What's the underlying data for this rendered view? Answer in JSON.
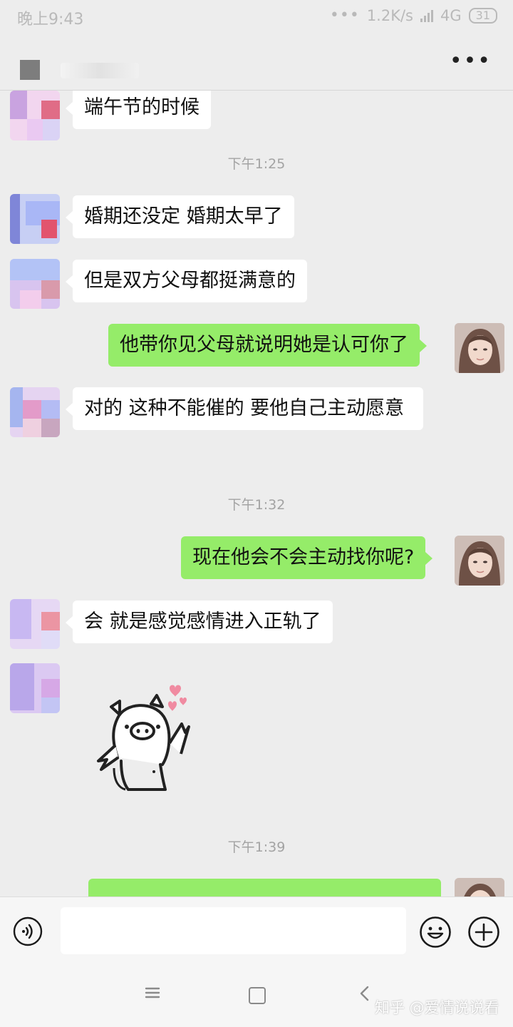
{
  "status_bar": {
    "time": "晚上9:43",
    "network_speed": "1.2K/s",
    "network_type": "4G",
    "battery": "31"
  },
  "title_bar": {
    "more_icon": "more-horizontal-icon"
  },
  "messages": [
    {
      "side": "in",
      "text": "端午节的时候"
    },
    {
      "side": "time",
      "text": "下午1:25"
    },
    {
      "side": "in",
      "text": "婚期还没定 婚期太早了"
    },
    {
      "side": "in",
      "text": "但是双方父母都挺满意的"
    },
    {
      "side": "out",
      "text": "他带你见父母就说明她是认可你了"
    },
    {
      "side": "in",
      "text": "对的 这种不能催的 要他自己主动愿意"
    },
    {
      "side": "time",
      "text": "下午1:32"
    },
    {
      "side": "out",
      "text": "现在他会不会主动找你呢?"
    },
    {
      "side": "in",
      "text": "会 就是感觉感情进入正轨了"
    },
    {
      "side": "in-sticker",
      "text": ""
    },
    {
      "side": "time",
      "text": "下午1:39"
    }
  ],
  "input_bar": {
    "voice_icon": "voice-input-icon",
    "emoji_icon": "emoji-icon",
    "plus_icon": "plus-icon"
  },
  "nav_bar": {
    "watermark": "知乎 @爱情说说看"
  },
  "colors": {
    "background": "#ededed",
    "incoming_bubble": "#ffffff",
    "outgoing_bubble": "#95ec69",
    "timestamp": "#a3a3a3"
  }
}
